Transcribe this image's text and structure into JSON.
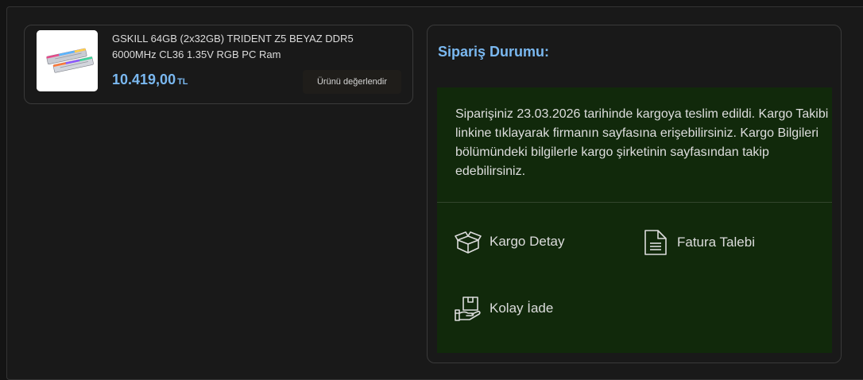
{
  "product": {
    "name": "GSKILL 64GB (2x32GB) TRIDENT Z5 BEYAZ DDR5 6000MHz CL36 1.35V RGB PC Ram",
    "price": "10.419,00",
    "currency": "TL",
    "review_label": "Ürünü değerlendir"
  },
  "order_status": {
    "title": "Sipariş Durumu:",
    "message": "Siparişiniz 23.03.2026 tarihinde kargoya teslim edildi. Kargo Takibi linkine tıklayarak firmanın sayfasına erişebilirsiniz. Kargo Bilgileri bölümündeki bilgilerle kargo şirketinin sayfasından takip edebilirsiniz.",
    "actions": [
      {
        "label": "Kargo Detay",
        "icon": "box-icon"
      },
      {
        "label": "Fatura Talebi",
        "icon": "document-icon"
      },
      {
        "label": "Kolay İade",
        "icon": "return-package-icon"
      }
    ]
  },
  "colors": {
    "accent": "#7ab8f0",
    "status_background": "#11290b",
    "page_background": "#141414"
  }
}
